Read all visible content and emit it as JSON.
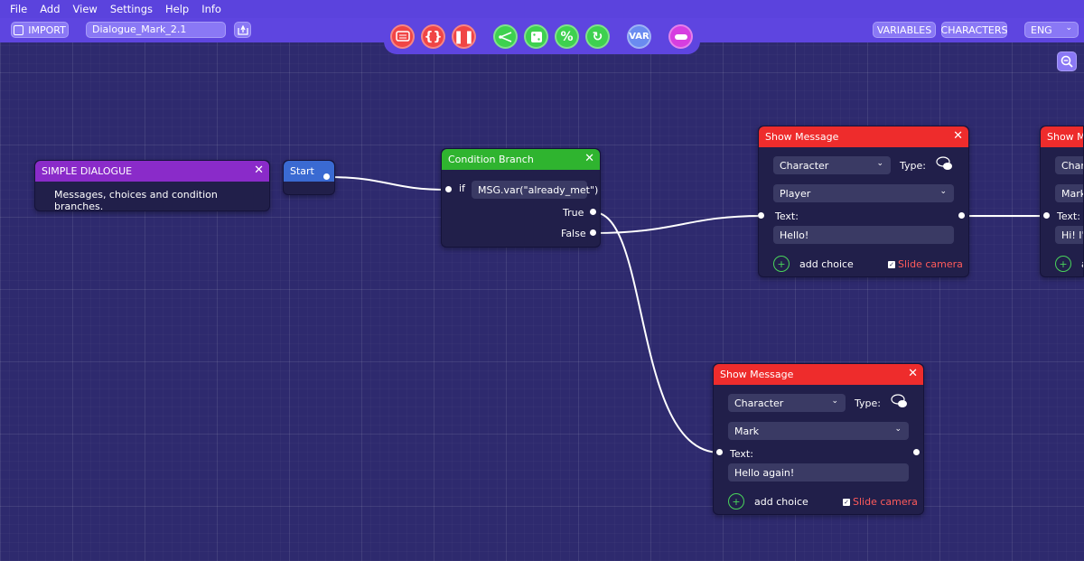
{
  "menu": [
    "File",
    "Add",
    "View",
    "Settings",
    "Help",
    "Info"
  ],
  "toolbar": {
    "import_label": "IMPORT",
    "filename": "Dialogue_Mark_2.1",
    "variables_label": "VARIABLES",
    "characters_label": "CHARACTERS",
    "language": "ENG",
    "var_label": "VAR"
  },
  "nodes": {
    "intro": {
      "title": "SIMPLE DIALOGUE",
      "text": "Messages, choices and condition branches."
    },
    "start": {
      "title": "Start"
    },
    "condition": {
      "title": "Condition Branch",
      "if_label": "if",
      "expression": "MSG.var(\"already_met\")",
      "true_label": "True",
      "false_label": "False"
    },
    "msg_player": {
      "title": "Show Message",
      "character_select": "Character",
      "type_label": "Type:",
      "speaker": "Player",
      "text_label": "Text:",
      "text": "Hello!",
      "add_choice": "add choice",
      "slide_camera": "Slide camera"
    },
    "msg_mark": {
      "title": "Show Message",
      "character_select": "Character",
      "type_label": "Type:",
      "speaker": "Mark",
      "text_label": "Text:",
      "text": "Hello again!",
      "add_choice": "add choice",
      "slide_camera": "Slide camera"
    },
    "msg_partial": {
      "title": "Show Me",
      "character_select": "Chara",
      "speaker": "Mark",
      "text_label": "Text:",
      "text": "Hi! I'm",
      "add_choice": "a"
    }
  },
  "colors": {
    "canvas": "#2e2a6e",
    "toolbar": "#5e45e0",
    "message_header": "#ee2c2c",
    "condition_header": "#2fb42f",
    "intro_header": "#8a2bc9",
    "start_header": "#3a6ad2"
  }
}
